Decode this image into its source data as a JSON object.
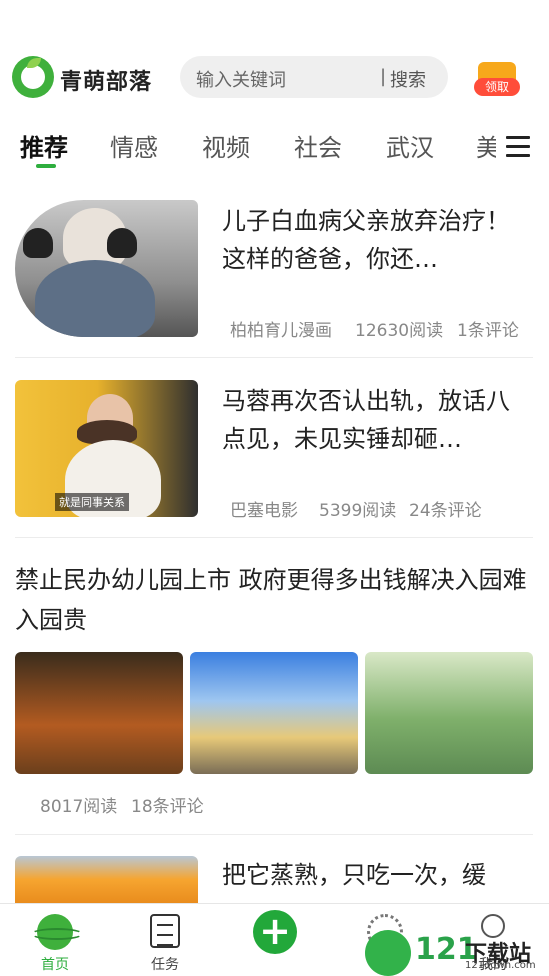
{
  "header": {
    "brand": "青萌部落",
    "search_placeholder": "输入关键词",
    "search_separator": "|",
    "search_button": "搜索",
    "gift_label": "领取"
  },
  "tabs": [
    "推荐",
    "情感",
    "视频",
    "社会",
    "武汉",
    "美"
  ],
  "articles": [
    {
      "title": "儿子白血病父亲放弃治疗！这样的爸爸，你还…",
      "source": "柏柏育儿漫画",
      "reads": "12630阅读",
      "comments": "1条评论"
    },
    {
      "title": "马蓉再次否认出轨，放话八点见，未见实锤却砸…",
      "source": "巴塞电影",
      "reads": "5399阅读",
      "comments": "24条评论",
      "image_caption": "就是同事关系"
    },
    {
      "title": "禁止民办幼儿园上市 政府更得多出钱解决入园难入园贵",
      "reads": "8017阅读",
      "comments": "18条评论"
    },
    {
      "title": "把它蒸熟，只吃一次，缓"
    }
  ],
  "bottom_nav": [
    {
      "label": "首页",
      "icon": "planet-icon",
      "active": true
    },
    {
      "label": "任务",
      "icon": "clipboard-icon"
    },
    {
      "label": "",
      "icon": "plus-icon"
    },
    {
      "label": "",
      "icon": "flower-icon"
    },
    {
      "label": "我的",
      "icon": "user-icon"
    }
  ],
  "watermark": {
    "number": "121",
    "text": "下载站",
    "url": "121down.com"
  },
  "colors": {
    "accent": "#2eae3e",
    "plus_button": "#22a83a",
    "gift_ribbon": "#ff4d3a"
  }
}
